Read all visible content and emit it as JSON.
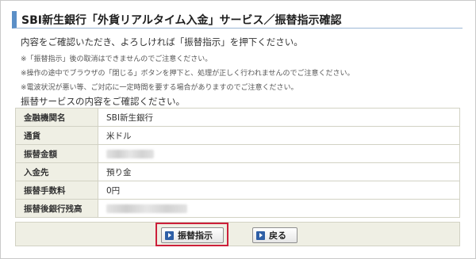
{
  "page": {
    "title": "SBI新生銀行「外貨リアルタイム入金」サービス／振替指示確認",
    "intro": "内容をご確認いただき、よろしければ「振替指示」を押下ください。",
    "notes": [
      "※「振替指示」後の取消はできませんのでご注意ください。",
      "※操作の途中でブラウザの「閉じる」ボタンを押下と、処理が正しく行われませんのでご注意ください。",
      "※電波状況が悪い等、ご対応に一定時間を要する場合がありますのでご注意ください。"
    ],
    "confirm_text": "振替サービスの内容をご確認ください。"
  },
  "details": [
    {
      "label": "金融機関名",
      "value": "SBI新生銀行"
    },
    {
      "label": "通貨",
      "value": "米ドル"
    },
    {
      "label": "振替金額",
      "value": ""
    },
    {
      "label": "入金先",
      "value": "預り金"
    },
    {
      "label": "振替手数料",
      "value": "0円"
    },
    {
      "label": "振替後銀行残高",
      "value": ""
    }
  ],
  "actions": {
    "transfer_label": "振替指示",
    "back_label": "戻る"
  },
  "colors": {
    "header_accent": "#5b8fc7",
    "label_bg": "#efefe4",
    "focus_ring": "#cc1f3a",
    "button_icon": "#2e5fa6"
  }
}
